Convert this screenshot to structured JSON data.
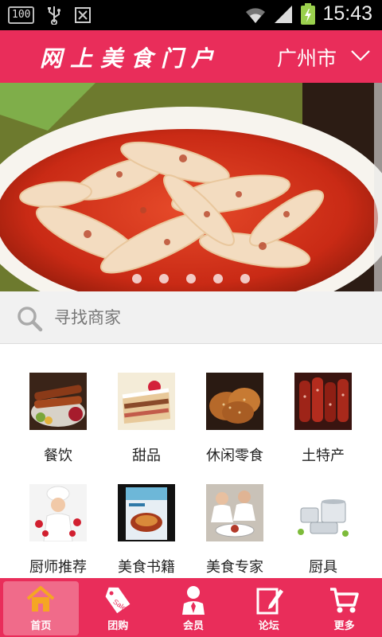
{
  "status_bar": {
    "badge": "100",
    "time": "15:43"
  },
  "header": {
    "title": "网上美食门户",
    "city": "广州市"
  },
  "banner": {
    "slide_count": 5
  },
  "search": {
    "placeholder": "寻找商家"
  },
  "categories": [
    {
      "label": "餐饮",
      "icon": "bbq-image"
    },
    {
      "label": "甜品",
      "icon": "cake-image"
    },
    {
      "label": "休闲零食",
      "icon": "biscuit-image"
    },
    {
      "label": "土特产",
      "icon": "sausage-image"
    },
    {
      "label": "厨师推荐",
      "icon": "chef-image"
    },
    {
      "label": "美食书籍",
      "icon": "cookbook-image"
    },
    {
      "label": "美食专家",
      "icon": "chefs-plating-image"
    },
    {
      "label": "厨具",
      "icon": "cookware-image"
    }
  ],
  "tabs": [
    {
      "label": "首页",
      "icon": "home-icon",
      "active": true
    },
    {
      "label": "团购",
      "icon": "sale-tag-icon",
      "active": false
    },
    {
      "label": "会员",
      "icon": "member-icon",
      "active": false
    },
    {
      "label": "论坛",
      "icon": "forum-icon",
      "active": false
    },
    {
      "label": "更多",
      "icon": "cart-icon",
      "active": false
    }
  ],
  "colors": {
    "brand": "#e92d5a",
    "tab_active": "#f06b8a"
  }
}
